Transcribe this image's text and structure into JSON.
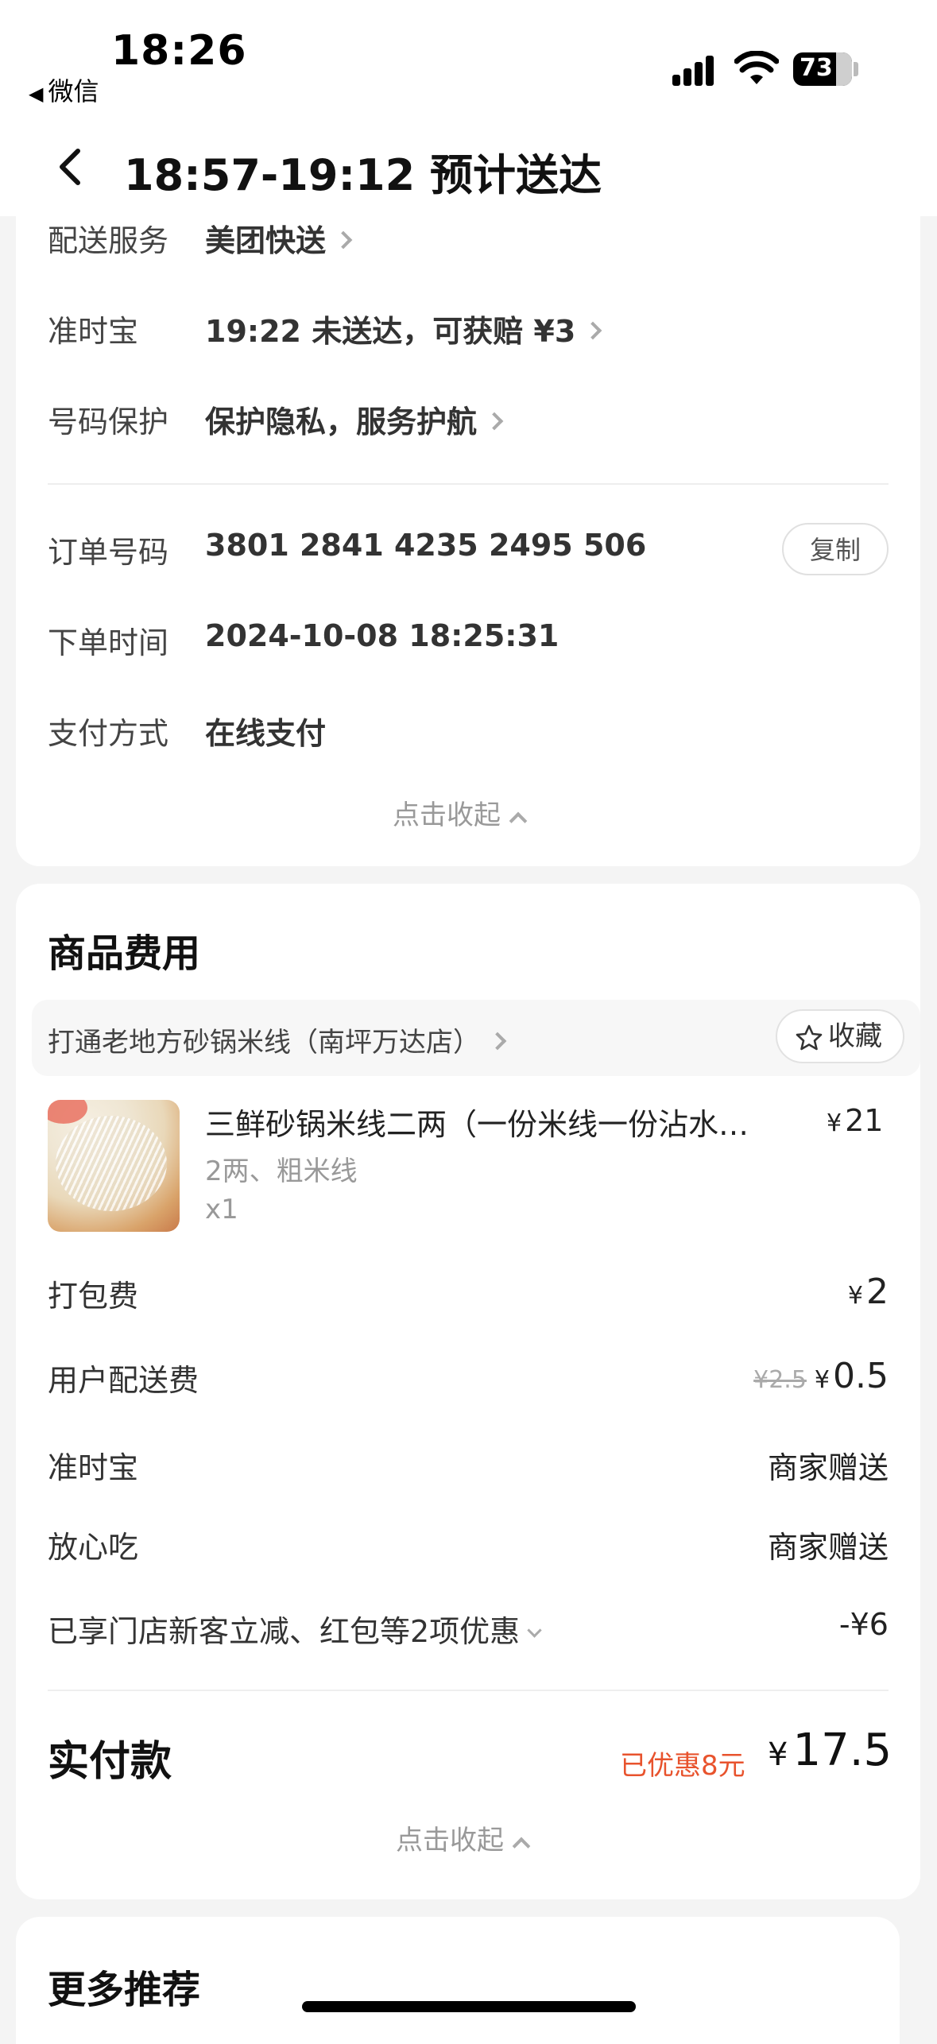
{
  "status_bar": {
    "time": "18:26",
    "back_app": "微信",
    "battery": "73"
  },
  "nav": {
    "title": "18:57-19:12 预计送达"
  },
  "order_info": {
    "rows": [
      {
        "label": "配送服务",
        "value": "美团快送"
      },
      {
        "label": "准时宝",
        "value": "19:22 未送达，可获赔 ¥3"
      },
      {
        "label": "号码保护",
        "value": "保护隐私，服务护航"
      }
    ],
    "order_no_label": "订单号码",
    "order_no": "3801 2841 4235 2495 506",
    "copy_label": "复制",
    "order_time_label": "下单时间",
    "order_time": "2024-10-08 18:25:31",
    "pay_method_label": "支付方式",
    "pay_method": "在线支付",
    "collapse_label": "点击收起"
  },
  "goods": {
    "title": "商品费用",
    "shop_name": "打通老地方砂锅米线（南坪万达店）",
    "fav_label": "收藏",
    "item": {
      "name": "三鲜砂锅米线二两（一份米线一份沾水…",
      "price_symbol": "¥",
      "price": "21",
      "spec": "2两、粗米线",
      "qty": "x1"
    },
    "packing_label": "打包费",
    "packing_value": "2",
    "delivery_label": "用户配送费",
    "delivery_original": "¥2.5",
    "delivery_value": "0.5",
    "ontime_label": "准时宝",
    "ontime_value": "商家赠送",
    "safe_label": "放心吃",
    "safe_value": "商家赠送",
    "discount_label": "已享门店新客立减、红包等2项优惠",
    "discount_value": "-¥6",
    "paid_label": "实付款",
    "paid_saved": "已优惠8元",
    "paid_symbol": "¥",
    "paid_value": "17.5",
    "collapse_label": "点击收起"
  },
  "more": {
    "title": "更多推荐"
  }
}
